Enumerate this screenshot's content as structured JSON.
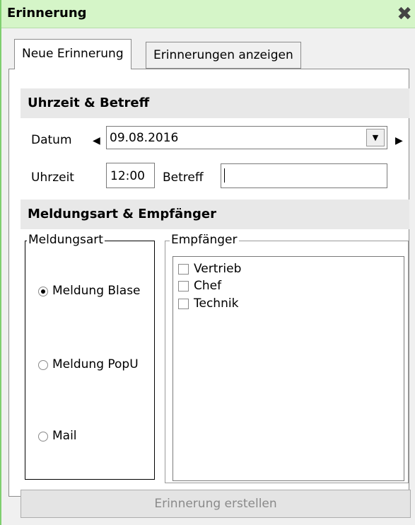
{
  "window": {
    "title": "Erinnerung",
    "close_icon": "close-icon"
  },
  "tabs": [
    {
      "label": "Neue Erinnerung",
      "active": true
    },
    {
      "label": "Erinnerungen anzeigen",
      "active": false
    }
  ],
  "time_section": {
    "title": "Uhrzeit & Betreff",
    "date_label": "Datum",
    "date_value": "09.08.2016",
    "time_label": "Uhrzeit",
    "time_value": "12:00",
    "subject_label": "Betreff",
    "subject_value": ""
  },
  "recipient_section": {
    "title": "Meldungsart & Empfänger",
    "type_group": "Meldungsart",
    "types": [
      {
        "label": "Meldung Blase",
        "checked": true
      },
      {
        "label": "Meldung PopU",
        "checked": false
      },
      {
        "label": "Mail",
        "checked": false
      }
    ],
    "recipient_group": "Empfänger",
    "recipients": [
      {
        "label": "Vertrieb",
        "checked": false
      },
      {
        "label": "Chef",
        "checked": false
      },
      {
        "label": "Technik",
        "checked": false
      }
    ]
  },
  "actions": {
    "create_label": "Erinnerung erstellen"
  },
  "colors": {
    "titlebar": "#d5f5c8",
    "border": "#7fcf6f",
    "section": "#e8e8e8"
  }
}
